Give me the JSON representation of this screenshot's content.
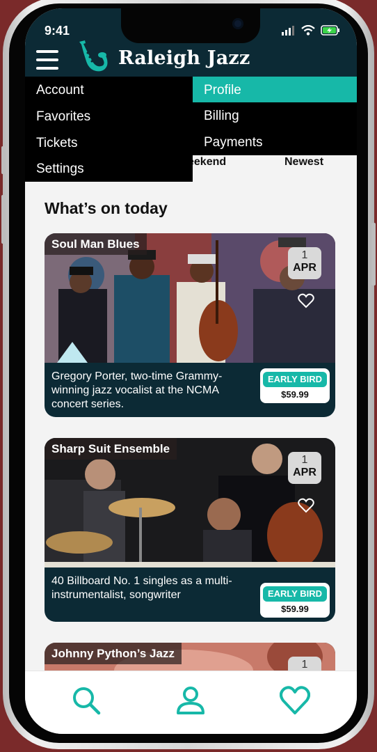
{
  "status": {
    "time": "9:41"
  },
  "app": {
    "brand": "Raleigh Jazz"
  },
  "menu": {
    "left": [
      "Account",
      "Favorites",
      "Tickets",
      "Settings"
    ],
    "right": [
      "Profile",
      "Billing",
      "Payments"
    ],
    "active": "Profile"
  },
  "filters": {
    "partial": "eekend",
    "newest": "Newest"
  },
  "section_title": "What’s on today",
  "events": [
    {
      "title": "Soul Man Blues",
      "day": "1",
      "month": "APR",
      "description": "Gregory Porter, two-time Grammy-winning jazz vocalist at the NCMA concert series.",
      "badge": "EARLY BIRD",
      "price": "$59.99"
    },
    {
      "title": "Sharp Suit Ensemble",
      "day": "1",
      "month": "APR",
      "description": "40 Billboard No. 1 singles as a multi-instrumentalist, songwriter",
      "badge": "EARLY BIRD",
      "price": "$59.99"
    },
    {
      "title": "Johnny Python’s Jazz",
      "day": "1"
    }
  ],
  "tabs": [
    "search-icon",
    "profile-icon",
    "heart-icon"
  ],
  "colors": {
    "accent": "#17b8a8",
    "dark": "#0c2a35",
    "frame": "#7a2a2a"
  }
}
